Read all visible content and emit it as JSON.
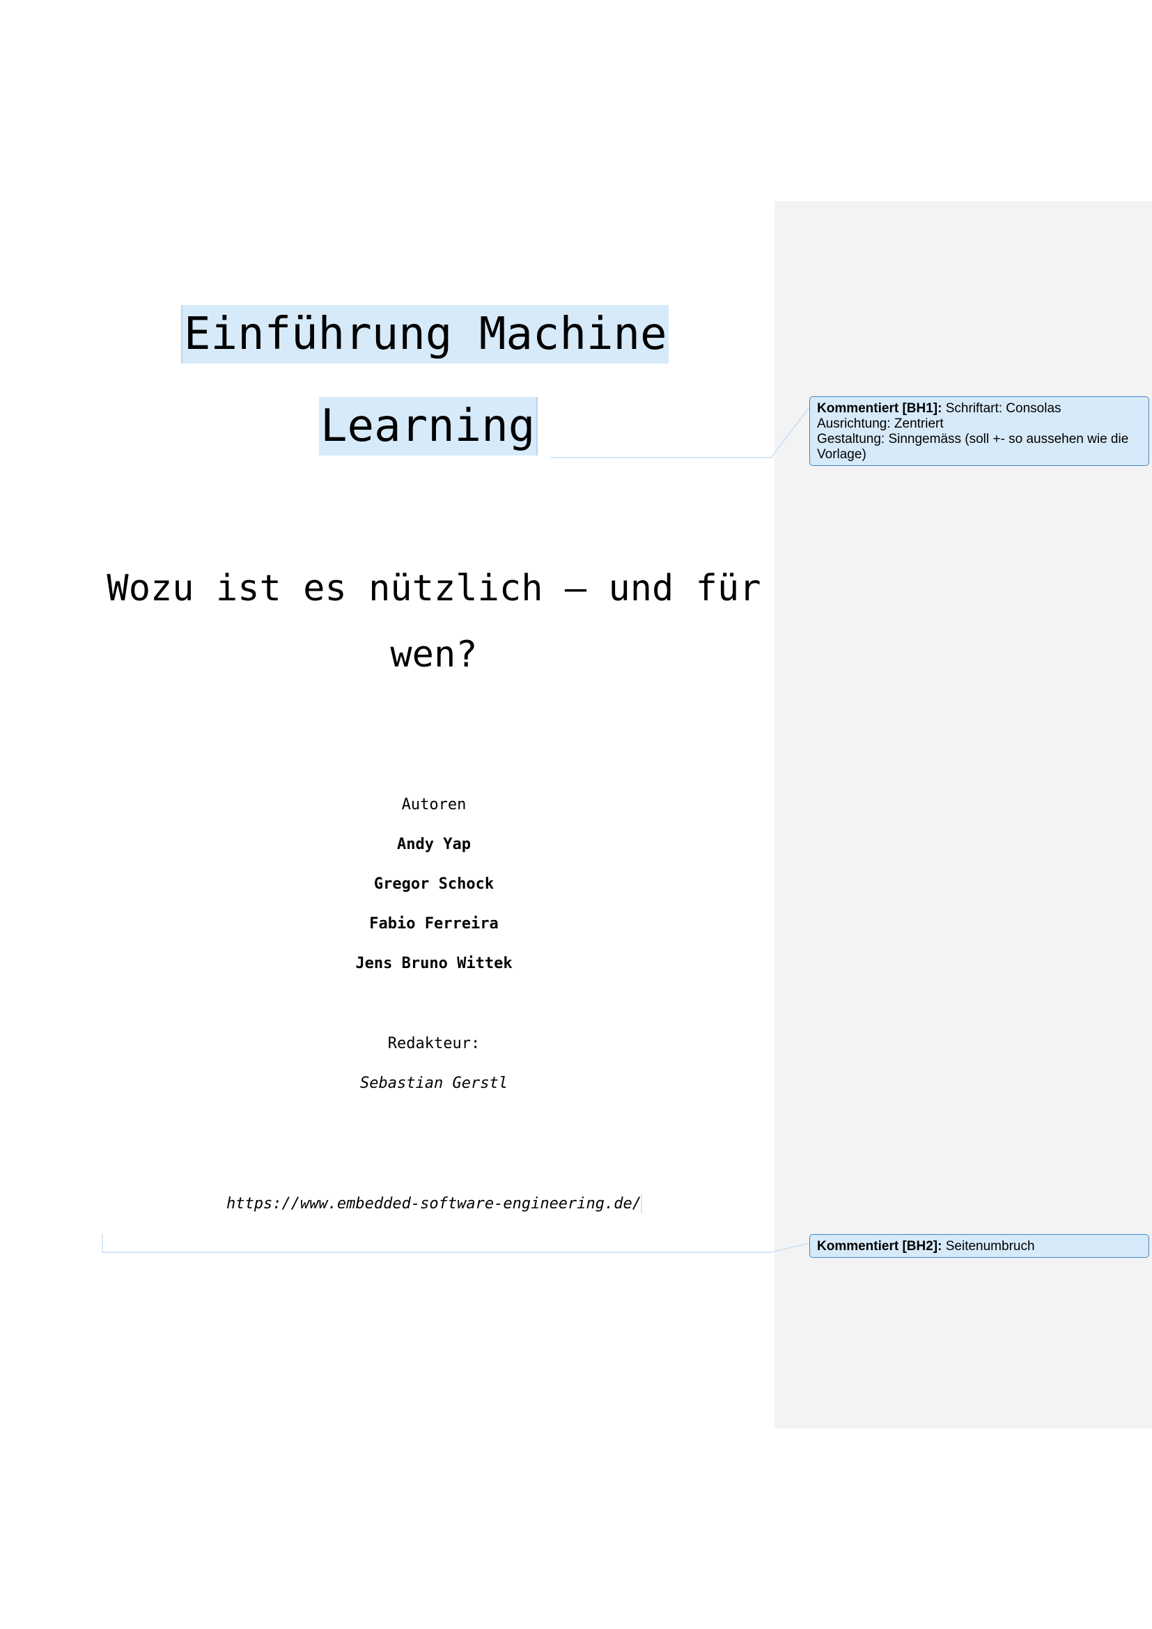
{
  "document": {
    "title_line1": "Einführung Machine",
    "title_line2": "Learning",
    "subtitle_line1": "Wozu ist es nützlich – und für",
    "subtitle_line2": "wen?",
    "authors_label": "Autoren",
    "authors": [
      "Andy Yap",
      "Gregor Schock",
      "Fabio Ferreira",
      "Jens Bruno Wittek"
    ],
    "editor_label": "Redakteur:",
    "editor": "Sebastian Gerstl",
    "url": "https://www.embedded-software-engineering.de/"
  },
  "comments": [
    {
      "label": "Kommentiert [BH1]:",
      "lines": [
        "Schriftart: Consolas",
        "Ausrichtung: Zentriert",
        "Gestaltung: Sinngemäss (soll +- so aussehen wie die Vorlage)"
      ]
    },
    {
      "label": "Kommentiert [BH2]:",
      "lines": [
        "Seitenumbruch"
      ]
    }
  ],
  "colors": {
    "highlight": "#d7eaf9",
    "comment_border": "#3d86c6",
    "comment_pane": "#f3f3f3"
  }
}
